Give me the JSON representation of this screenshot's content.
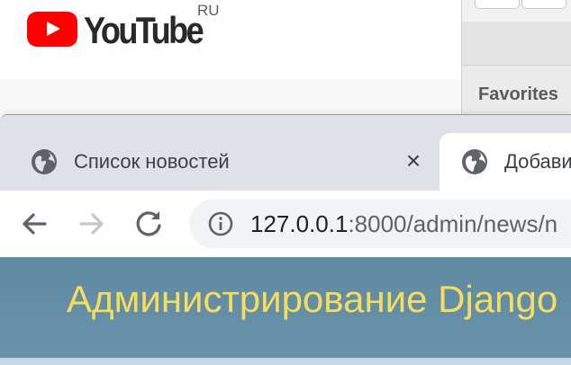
{
  "youtube": {
    "brand": "YouTube",
    "country_code": "RU",
    "logo_color": "#ff0000"
  },
  "side_window": {
    "favorites_label": "Favorites"
  },
  "browser": {
    "tabs": [
      {
        "title": "Список новостей",
        "icon": "globe-icon",
        "active": false
      },
      {
        "title": "Добавить",
        "icon": "globe-icon",
        "active": true
      }
    ],
    "toolbar": {
      "back": "arrow-left-icon",
      "forward": "arrow-right-icon",
      "reload": "reload-icon"
    },
    "address": {
      "host": "127.0.0.1",
      "rest": ":8000/admin/news/n"
    }
  },
  "page": {
    "header_title": "Администрирование Django",
    "header_color": "#417690",
    "title_color": "#f5dd5d"
  }
}
